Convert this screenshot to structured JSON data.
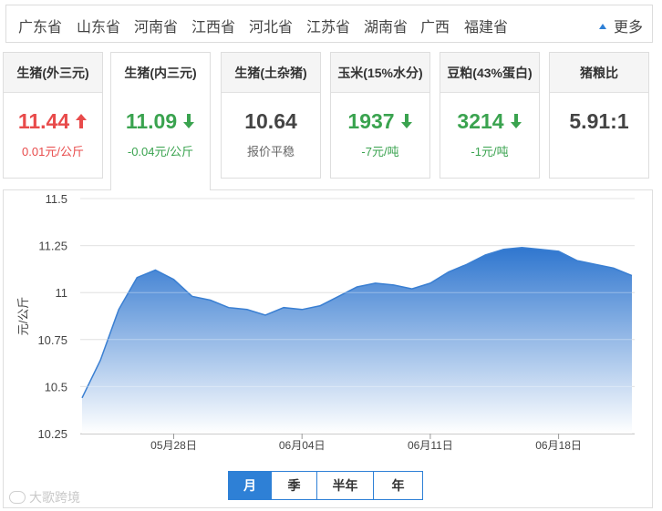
{
  "provinces": [
    "广东省",
    "山东省",
    "河南省",
    "江西省",
    "河北省",
    "江苏省",
    "湖南省",
    "广西",
    "福建省"
  ],
  "more_label": "更多",
  "cards": [
    {
      "title": "生猪(外三元)",
      "value": "11.44",
      "trend": "up",
      "arrow": "🡑",
      "change": "0.01元/公斤"
    },
    {
      "title": "生猪(内三元)",
      "value": "11.09",
      "trend": "down",
      "arrow": "🡓",
      "change": "-0.04元/公斤"
    },
    {
      "title": "生猪(土杂猪)",
      "value": "10.64",
      "trend": "flat",
      "arrow": "",
      "change": "报价平稳"
    },
    {
      "title": "玉米(15%水分)",
      "value": "1937",
      "trend": "down",
      "arrow": "🡓",
      "change": "-7元/吨"
    },
    {
      "title": "豆粕(43%蛋白)",
      "value": "3214",
      "trend": "down",
      "arrow": "🡓",
      "change": "-1元/吨"
    },
    {
      "title": "猪粮比",
      "value": "5.91:1",
      "trend": "flat",
      "arrow": "",
      "change": ""
    }
  ],
  "active_card": 1,
  "periods": [
    "月",
    "季",
    "半年",
    "年"
  ],
  "active_period": 0,
  "watermark": "大歌跨境",
  "colors": {
    "accent": "#2e80d6",
    "up": "#e84b4b",
    "down": "#3aa34f",
    "area_top": "#2f76cf",
    "area_bottom": "#ffffff"
  },
  "chart_data": {
    "type": "area",
    "ylabel": "元/公斤",
    "xlabel": "",
    "ylim": [
      10.25,
      11.5
    ],
    "yticks": [
      "11.5",
      "11.25",
      "11",
      "10.75",
      "10.5",
      "10.25"
    ],
    "ytick_values": [
      11.5,
      11.25,
      11.0,
      10.75,
      10.5,
      10.25
    ],
    "xticks": [
      {
        "label": "05月28日",
        "day": 28,
        "month": 5
      },
      {
        "label": "06月04日",
        "day": 4,
        "month": 6
      },
      {
        "label": "06月11日",
        "day": 11,
        "month": 6
      },
      {
        "label": "06月18日",
        "day": 18,
        "month": 6
      }
    ],
    "x": [
      "05-23",
      "05-24",
      "05-25",
      "05-26",
      "05-27",
      "05-28",
      "05-29",
      "05-30",
      "05-31",
      "06-01",
      "06-02",
      "06-03",
      "06-04",
      "06-05",
      "06-06",
      "06-07",
      "06-08",
      "06-09",
      "06-10",
      "06-11",
      "06-12",
      "06-13",
      "06-14",
      "06-15",
      "06-16",
      "06-17",
      "06-18",
      "06-19",
      "06-20",
      "06-21",
      "06-22",
      "06-23"
    ],
    "values": [
      10.44,
      10.64,
      10.91,
      11.08,
      11.12,
      11.07,
      10.98,
      10.96,
      10.92,
      10.91,
      10.88,
      10.92,
      10.91,
      10.93,
      10.98,
      11.03,
      11.05,
      11.04,
      11.02,
      11.05,
      11.11,
      11.15,
      11.2,
      11.23,
      11.24,
      11.23,
      11.22,
      11.17,
      11.15,
      11.13,
      11.09
    ],
    "grid": true
  }
}
